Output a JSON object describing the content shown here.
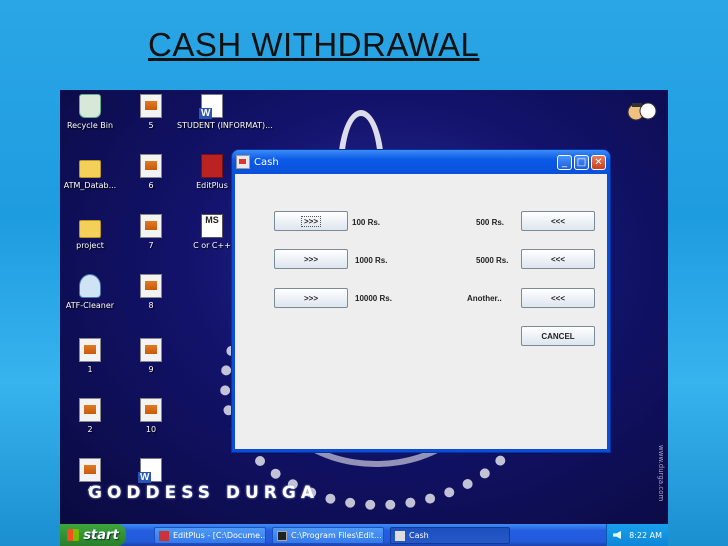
{
  "slide": {
    "title": "CASH WITHDRAWAL"
  },
  "desktop": {
    "icons": [
      {
        "label": "Recycle Bin",
        "icon": "recycle-bin-icon"
      },
      {
        "label": "5",
        "icon": "file-icon"
      },
      {
        "label": "STUDENT (INFORMAT)...",
        "icon": "word-doc-icon"
      },
      {
        "label": "ATM_Datab...",
        "icon": "folder-icon"
      },
      {
        "label": "6",
        "icon": "file-icon"
      },
      {
        "label": "EditPlus",
        "icon": "editplus-icon"
      },
      {
        "label": "project",
        "icon": "folder-icon"
      },
      {
        "label": "7",
        "icon": "file-icon"
      },
      {
        "label": "C or C++",
        "icon": "c-cpp-icon"
      },
      {
        "label": "ATF-Cleaner",
        "icon": "cleaner-icon"
      },
      {
        "label": "8",
        "icon": "file-icon"
      },
      {
        "label": "1",
        "icon": "file-icon"
      },
      {
        "label": "9",
        "icon": "file-icon"
      },
      {
        "label": "2",
        "icon": "file-icon"
      },
      {
        "label": "10",
        "icon": "file-icon"
      },
      {
        "label": "4",
        "icon": "file-icon"
      },
      {
        "label": "",
        "icon": "word-doc-icon"
      }
    ],
    "banner": "GODDESS DURGA",
    "side_text": "www.durga.com"
  },
  "window": {
    "title": "Cash",
    "controls": {
      "minimize": "_",
      "maximize": "□",
      "close": "✕"
    },
    "left_buttons": [
      ">>>",
      ">>>",
      ">>>"
    ],
    "left_labels": [
      "100 Rs.",
      "1000 Rs.",
      "10000 Rs."
    ],
    "right_labels": [
      "500 Rs.",
      "5000 Rs.",
      "Another.."
    ],
    "right_buttons": [
      "<<<",
      "<<<",
      "<<<"
    ],
    "cancel": "CANCEL"
  },
  "taskbar": {
    "start": "start",
    "tasks": [
      "EditPlus - [C:\\Docume...",
      "C:\\Program Files\\Edit...",
      "Cash"
    ],
    "clock": "8:22 AM"
  },
  "colors": {
    "title_bar": "#0b5ae8",
    "client_bg": "#eeeeee",
    "start_green": "#2f8f2f",
    "slide_bg": "#2aa6e6"
  }
}
